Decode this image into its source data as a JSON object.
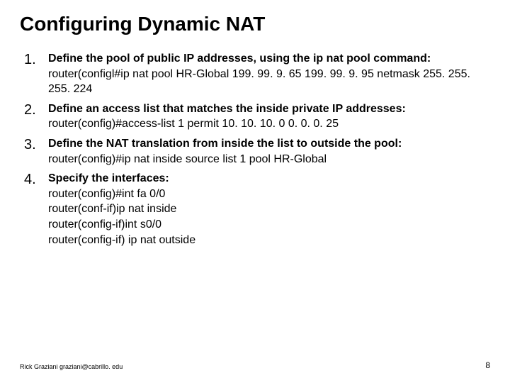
{
  "title": "Configuring Dynamic NAT",
  "items": [
    {
      "num": "1.",
      "lead": "Define the pool of public IP addresses, using the ip nat pool command:",
      "cmds": [
        "router(configl#ip nat pool HR-Global 199. 99. 9. 65 199. 99. 9. 95 netmask 255. 255. 255. 224"
      ]
    },
    {
      "num": "2.",
      "lead": "Define an access list that matches the inside private IP addresses:",
      "cmds": [
        "router(config)#access-list 1 permit 10. 10. 10. 0 0. 0. 0. 25"
      ]
    },
    {
      "num": "3.",
      "lead": "Define the NAT translation from inside the list to outside the pool:",
      "cmds": [
        "router(config)#ip nat inside source list 1 pool HR-Global"
      ]
    },
    {
      "num": "4.",
      "lead": "Specify the interfaces:",
      "cmds": [
        "router(config)#int fa 0/0",
        "router(conf-if)ip nat inside",
        "router(config-if)int s0/0",
        "router(config-if) ip nat outside"
      ]
    }
  ],
  "footer_left": "Rick Graziani  graziani@cabrillo. edu",
  "footer_right": "8"
}
